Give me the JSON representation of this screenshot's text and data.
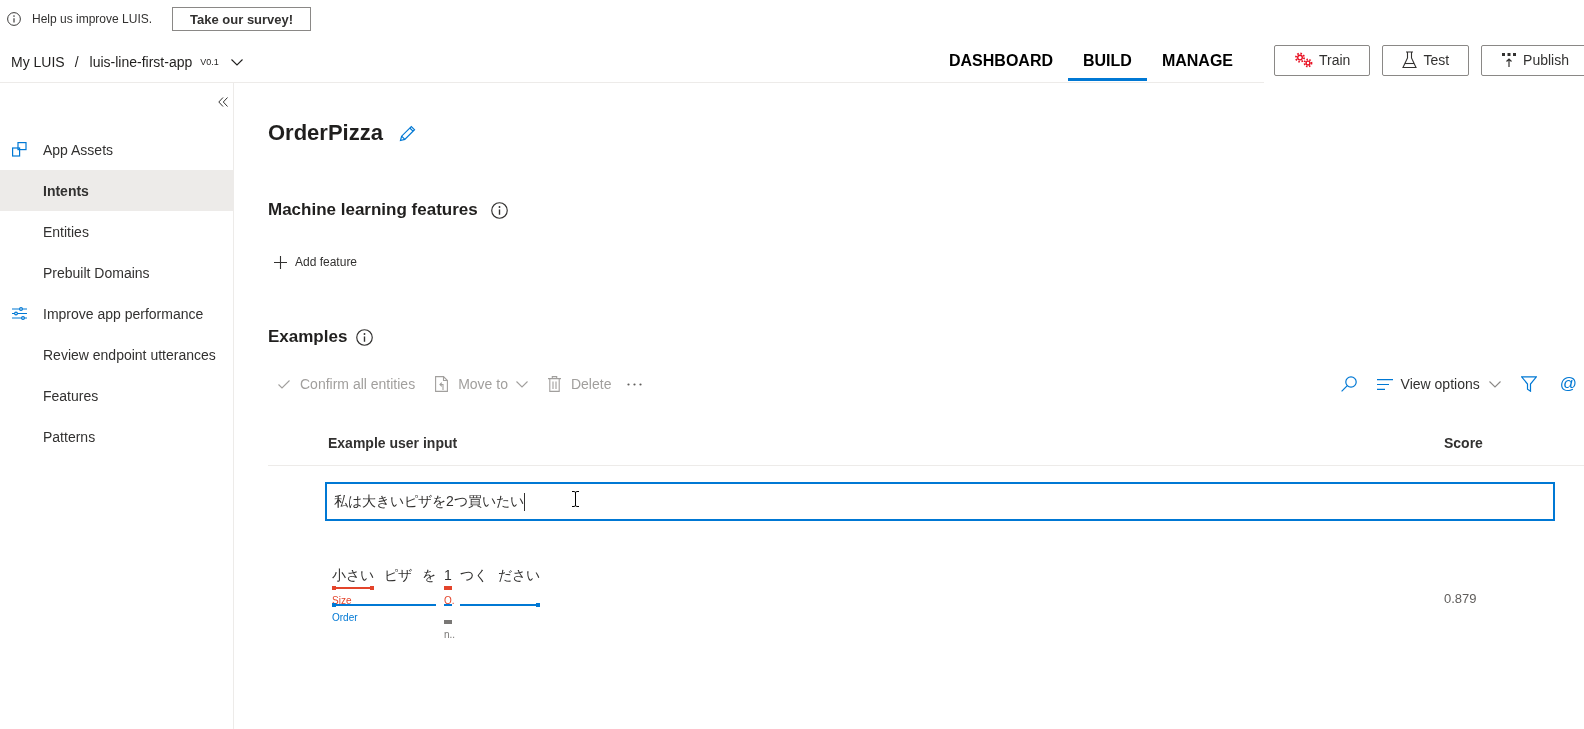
{
  "banner": {
    "text": "Help us improve LUIS.",
    "button": "Take our survey!"
  },
  "header": {
    "breadcrumb": {
      "root": "My LUIS",
      "separator": "/",
      "app": "luis-line-first-app",
      "version": "V0.1"
    },
    "tabs": [
      {
        "label": "DASHBOARD",
        "selected": false
      },
      {
        "label": "BUILD",
        "selected": true
      },
      {
        "label": "MANAGE",
        "selected": false
      }
    ],
    "buttons": [
      {
        "label": "Train",
        "kind": "train"
      },
      {
        "label": "Test",
        "kind": "test"
      },
      {
        "label": "Publish",
        "kind": "publish"
      }
    ]
  },
  "sidebar": {
    "items": [
      {
        "label": "App Assets",
        "kind": "assets",
        "selected": false
      },
      {
        "label": "Intents",
        "kind": "link",
        "selected": true
      },
      {
        "label": "Entities",
        "kind": "link",
        "selected": false
      },
      {
        "label": "Prebuilt Domains",
        "kind": "link",
        "selected": false
      },
      {
        "label": "Improve app performance",
        "kind": "tune",
        "selected": false
      },
      {
        "label": "Review endpoint utterances",
        "kind": "link",
        "selected": false
      },
      {
        "label": "Features",
        "kind": "link",
        "selected": false
      },
      {
        "label": "Patterns",
        "kind": "link",
        "selected": false
      }
    ]
  },
  "intent": {
    "title": "OrderPizza"
  },
  "features": {
    "heading": "Machine learning features",
    "add_button": "Add feature"
  },
  "examples": {
    "heading": "Examples",
    "toolbar": {
      "actions": [
        {
          "label": "Confirm all entities",
          "kind": "confirm",
          "disabled": true
        },
        {
          "label": "Move to",
          "kind": "move",
          "disabled": true
        },
        {
          "label": "Delete",
          "kind": "delete",
          "disabled": true
        }
      ],
      "view_options": "View options",
      "mention": "@"
    },
    "table": {
      "columns": [
        "Example user input",
        "Score"
      ],
      "new_example": {
        "value": "私は大きいピザを2つ買いたい",
        "focused": true
      },
      "rows": [
        {
          "groups": [
            {
              "tokens": [
                {
                  "text": "小さい",
                  "child": {
                    "label": "Size",
                    "color": "#e3442b"
                  }
                },
                {
                  "text": "ピザ"
                },
                {
                  "text": "を"
                }
              ],
              "entity": {
                "label": "Order",
                "color": "#0078d4",
                "kind": "start"
              }
            },
            {
              "tokens": [
                {
                  "text": "1",
                  "child": {
                    "label": "Q.",
                    "color": "#e3442b"
                  }
                }
              ],
              "entity": {
                "color": "#0078d4",
                "kind": "middle"
              },
              "feature": {
                "label": "n..",
                "color": "#797775"
              }
            },
            {
              "tokens": [
                {
                  "text": "つく"
                },
                {
                  "text": "ださい"
                }
              ],
              "entity": {
                "color": "#0078d4",
                "kind": "end"
              }
            }
          ],
          "score": "0.879"
        }
      ]
    }
  }
}
